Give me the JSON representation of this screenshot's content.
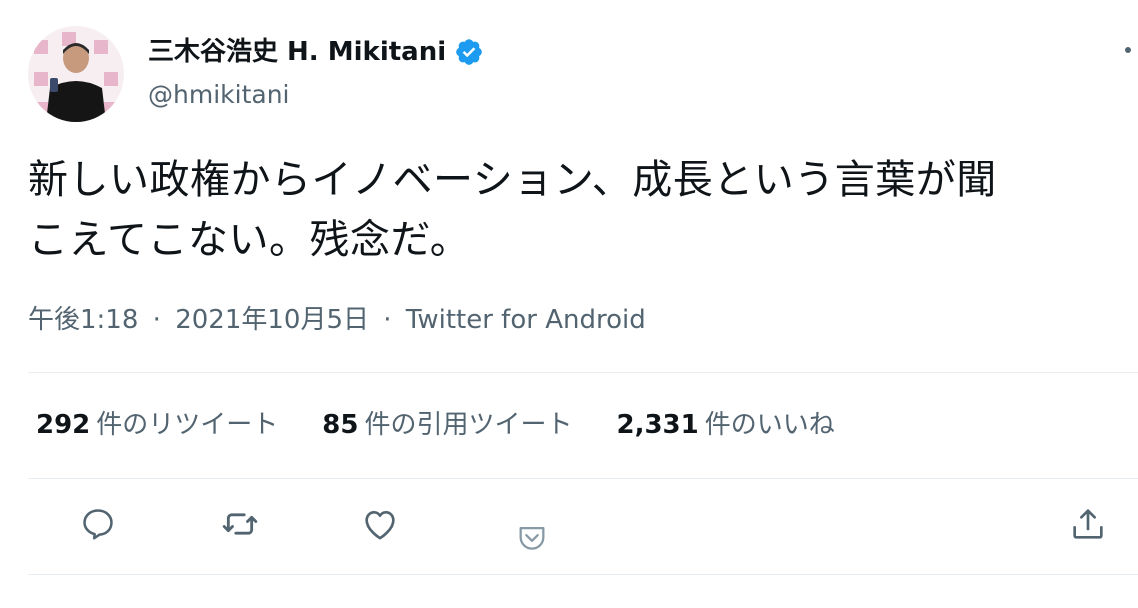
{
  "user": {
    "display_name": "三木谷浩史 H. Mikitani",
    "handle": "@hmikitani",
    "verified": true,
    "verified_color": "#1d9bf0"
  },
  "tweet": {
    "text": "新しい政権からイノベーション、成長という言葉が聞\nこえてこない。残念だ。",
    "time": "午後1:18",
    "date": "2021年10月5日",
    "source": "Twitter for Android",
    "separator": "·"
  },
  "stats": [
    {
      "count": "292",
      "label": "件のリツイート"
    },
    {
      "count": "85",
      "label": "件の引用ツイート"
    },
    {
      "count": "2,331",
      "label": "件のいいね"
    }
  ],
  "actions": [
    {
      "icon": "reply-icon"
    },
    {
      "icon": "retweet-icon"
    },
    {
      "icon": "like-icon"
    },
    {
      "icon": "pocket-icon"
    },
    {
      "icon": "share-icon"
    }
  ],
  "colors": {
    "text": "#0f1419",
    "secondary": "#536471",
    "divider": "#e6ecf0",
    "pocket": "#8899a6"
  }
}
